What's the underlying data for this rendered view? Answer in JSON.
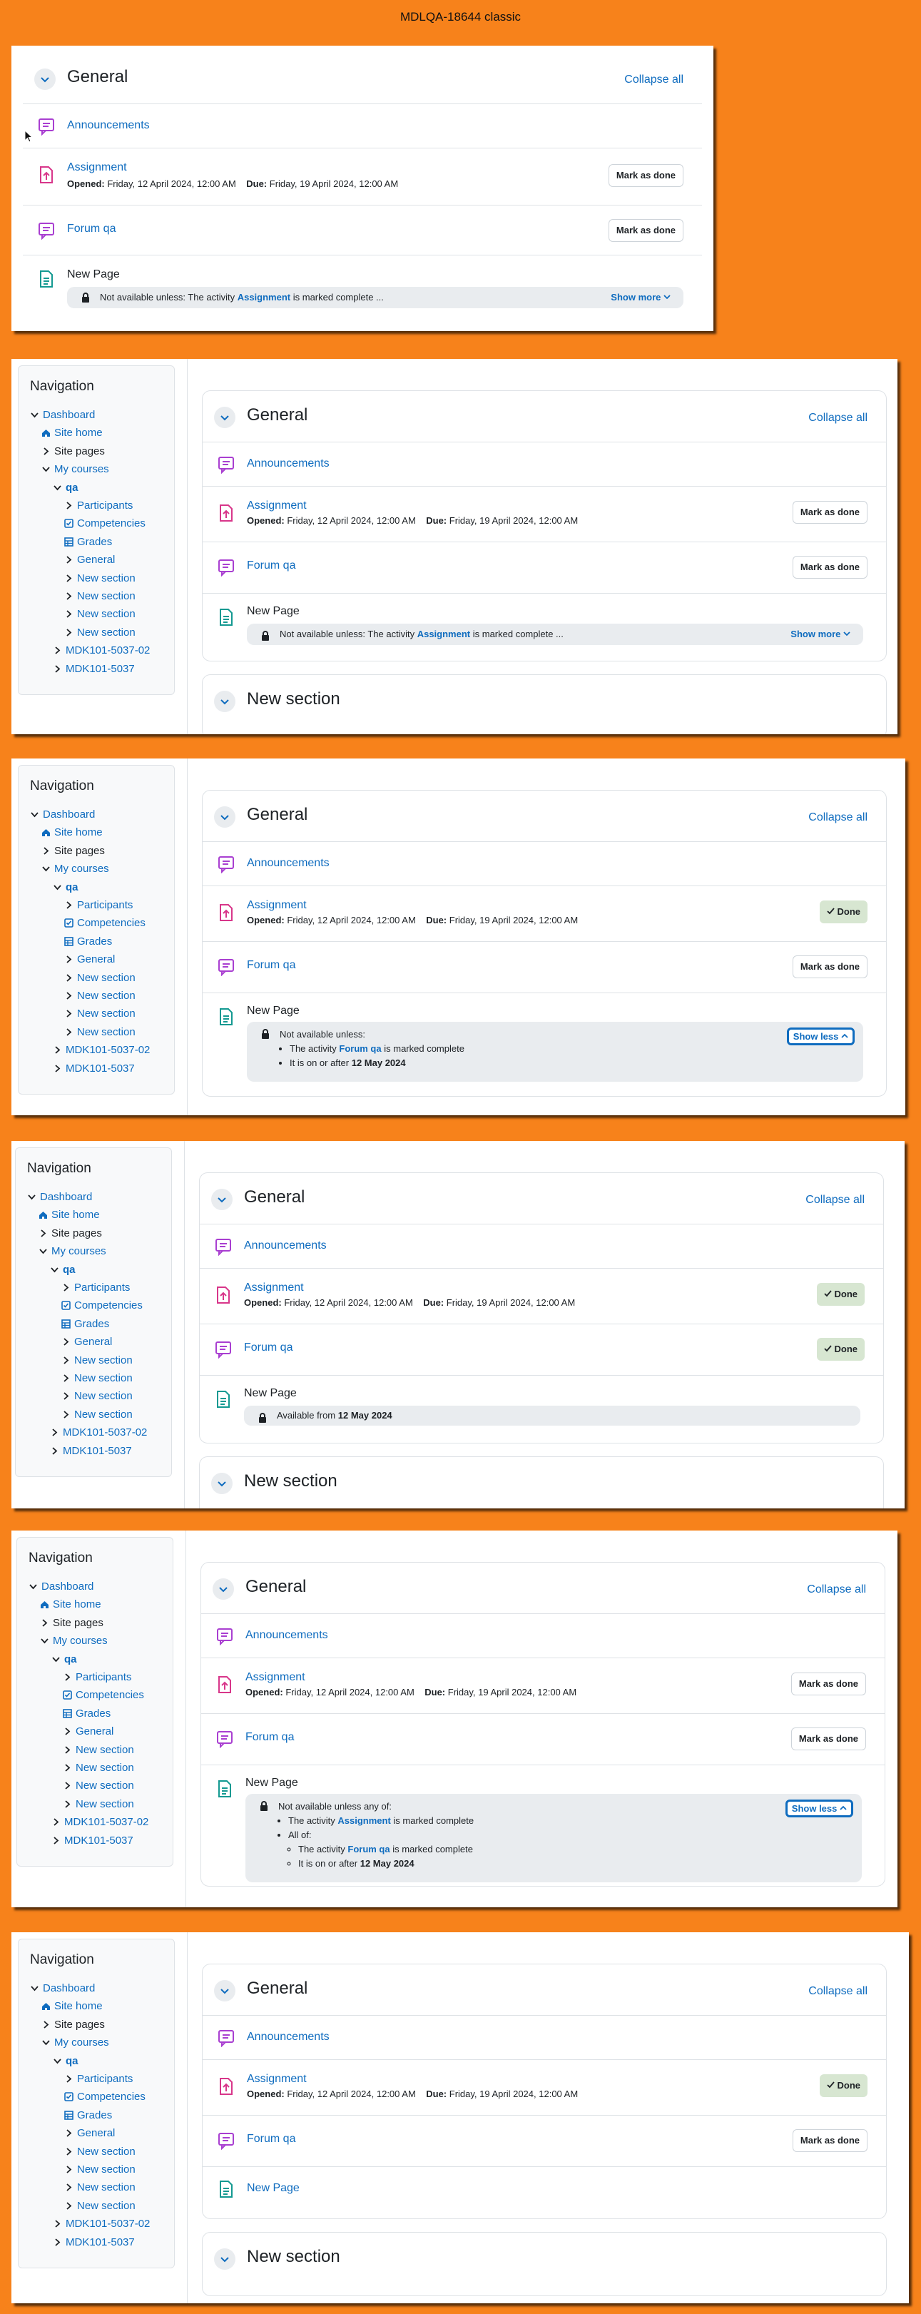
{
  "page_title": "MDLQA-18644 classic",
  "section": {
    "general": "General",
    "collapse_all": "Collapse all",
    "new_section": "New section"
  },
  "activities": {
    "announcements": "Announcements",
    "assignment": "Assignment",
    "forum": "Forum qa",
    "new_page": "New Page"
  },
  "dates": {
    "opened_label": "Opened:",
    "opened_value": "Friday, 12 April 2024, 12:00 AM",
    "due_label": "Due:",
    "due_value": "Friday, 19 April 2024, 12:00 AM"
  },
  "buttons": {
    "mark_as_done": "Mark as done",
    "done": "Done",
    "show_more": "Show more",
    "show_less": "Show less"
  },
  "restrictions": {
    "r1_prefix": "Not available unless: The activity",
    "r1_link": "Assignment",
    "r1_suffix": "is marked complete ...",
    "r3_head": "Not available unless:",
    "r3_item1_prefix": "The activity",
    "r3_item1_link": "Forum qa",
    "r3_item1_suffix": "is marked complete",
    "r3_item2_prefix": "It is on or after",
    "r3_item2_date": "12 May 2024",
    "r4_prefix": "Available from",
    "r4_date": "12 May 2024",
    "r5_head": "Not available unless any of:",
    "r5_item1_prefix": "The activity",
    "r5_item1_link": "Assignment",
    "r5_item1_suffix": "is marked complete",
    "r5_item2": "All of:",
    "r5_sub1_prefix": "The activity",
    "r5_sub1_link": "Forum qa",
    "r5_sub1_suffix": "is marked complete",
    "r5_sub2_prefix": "It is on or after",
    "r5_sub2_date": "12 May 2024"
  },
  "nav": {
    "title": "Navigation",
    "dashboard": "Dashboard",
    "site_home": "Site home",
    "site_pages": "Site pages",
    "my_courses": "My courses",
    "qa": "qa",
    "participants": "Participants",
    "competencies": "Competencies",
    "grades": "Grades",
    "general": "General",
    "new_section": "New section",
    "course2": "MDK101-5037-02",
    "course3": "MDK101-5037"
  },
  "colors": {
    "background": "#f7821b",
    "link": "#0f6cbf",
    "forum_icon": "#a93fd1",
    "assign_icon": "#d8368a",
    "page_icon": "#139991",
    "done_bg": "#d7e6d1"
  }
}
